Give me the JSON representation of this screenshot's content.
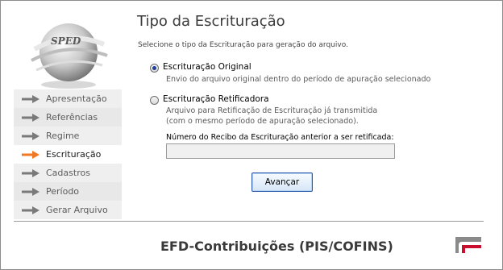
{
  "header": {
    "title": "Tipo da Escrituração",
    "subtitle": "Selecione o tipo da Escrituração para geração do arquivo."
  },
  "logo": {
    "text": "SPED"
  },
  "sidebar": {
    "items": [
      {
        "label": "Apresentação",
        "active": false
      },
      {
        "label": "Referências",
        "active": false
      },
      {
        "label": "Regime",
        "active": false
      },
      {
        "label": "Escrituração",
        "active": true
      },
      {
        "label": "Cadastros",
        "active": false
      },
      {
        "label": "Período",
        "active": false
      },
      {
        "label": "Gerar Arquivo",
        "active": false
      }
    ]
  },
  "options": {
    "original": {
      "label": "Escrituração Original",
      "description": "Envio do arquivo original dentro do período de apuração selecionado",
      "selected": true
    },
    "retificadora": {
      "label": "Escrituração Retificadora",
      "description_line1": "Arquivo para Retificação de Escrituração já transmitida",
      "description_line2": "(com o mesmo período de apuração selecionado).",
      "selected": false
    }
  },
  "receipt": {
    "label": "Número do Recibo da Escrituração anterior a ser retificada:",
    "value": ""
  },
  "actions": {
    "next_label": "Avançar"
  },
  "footer": {
    "title": "EFD-Contribuições (PIS/COFINS)"
  },
  "colors": {
    "accent_arrow": "#f07820",
    "inactive_arrow": "#7a7a7a",
    "brand_red": "#c8102e"
  }
}
